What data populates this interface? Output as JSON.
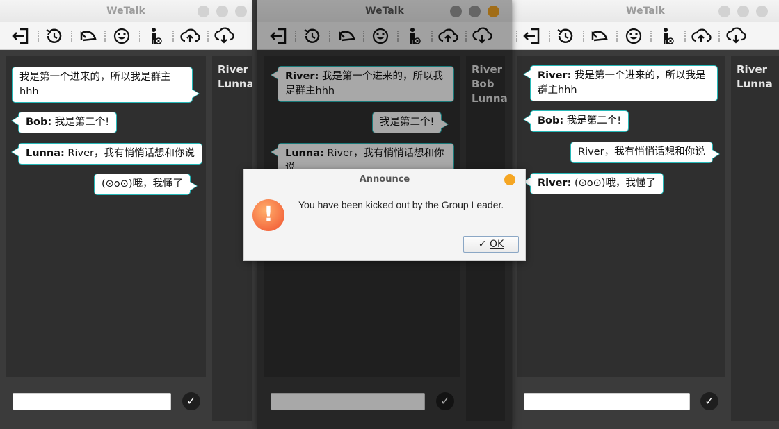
{
  "app_title": "WeTalk",
  "toolbar_icons": [
    "logout-icon",
    "history-icon",
    "undo-icon",
    "emoji-icon",
    "kick-user-icon",
    "upload-icon",
    "download-icon"
  ],
  "colors": {
    "bubble_border": "#26b8b8",
    "panel_bg": "#2f2f2f",
    "dialog_close": "#f5a623"
  },
  "windows": [
    {
      "messages": [
        {
          "sender": "",
          "text": "我是第一个进来的，所以我是群主hhh"
        },
        {
          "sender": "Bob:",
          "text": " 我是第二个!"
        },
        {
          "sender": "Lunna:",
          "text": " River，我有悄悄话想和你说"
        },
        {
          "sender": "",
          "text": "(⊙o⊙)哦，我懂了"
        }
      ],
      "users": [
        "River",
        "Lunna"
      ]
    },
    {
      "messages": [
        {
          "sender": "River:",
          "text": " 我是第一个进来的，所以我是群主hhh"
        },
        {
          "sender": "",
          "text": "我是第二个!"
        },
        {
          "sender": "Lunna:",
          "text": " River，我有悄悄话想和你说"
        }
      ],
      "users": [
        "River",
        "Bob",
        "Lunna"
      ]
    },
    {
      "messages": [
        {
          "sender": "River:",
          "text": " 我是第一个进来的，所以我是群主hhh"
        },
        {
          "sender": "Bob:",
          "text": " 我是第二个!"
        },
        {
          "sender": "",
          "text": "River，我有悄悄话想和你说"
        },
        {
          "sender": "River:",
          "text": " (⊙o⊙)哦，我懂了"
        }
      ],
      "users": [
        "River",
        "Lunna"
      ]
    }
  ],
  "dialog": {
    "title": "Announce",
    "message": "You have been kicked out by the Group Leader.",
    "ok_label": "OK",
    "icon": "warning-icon"
  }
}
